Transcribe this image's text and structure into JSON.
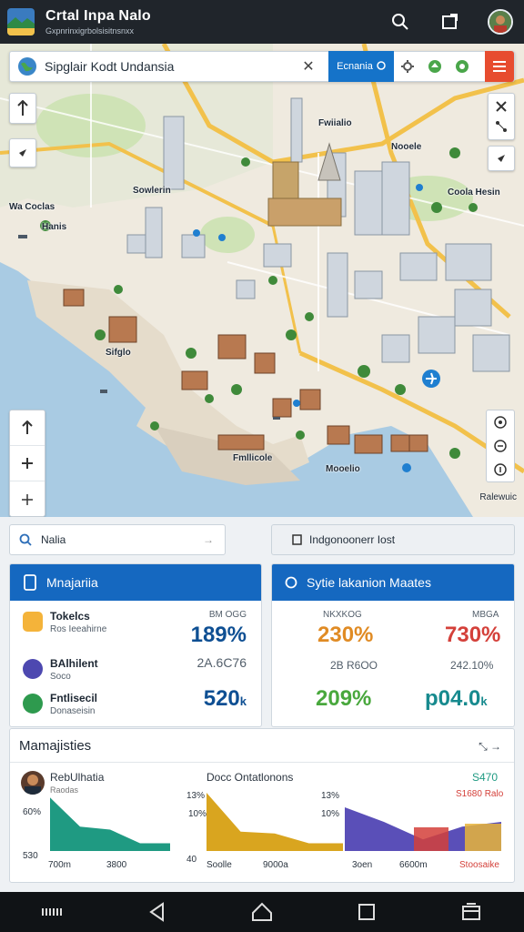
{
  "app": {
    "title": "Crtal Inpa Nalo",
    "subtitle": "Gxpnrinxigrbolsisitnsnxx"
  },
  "search": {
    "value": "Sipglair Kodt Undansia",
    "chip_label": "Ecnania"
  },
  "map_labels": [
    "Sowlerin",
    "Wa Coclas",
    "Hanis",
    "Sifglo",
    "Nooele",
    "Coola Hesin",
    "Fmllicole",
    "Mooelio",
    "Fwiialio",
    "Ralewuic"
  ],
  "attribution": "Ralewuic",
  "fields": {
    "left_value": "Nalia",
    "right_value": "Indgonoonerr Iost"
  },
  "left_card": {
    "title": "Mnajariia",
    "rows": [
      {
        "title": "Tokelcs",
        "sub": "Ros Ieeahirne",
        "small": "BM OGG",
        "big": "189%",
        "icon_color": "#f0a326"
      },
      {
        "title": "BAlhilent",
        "sub": "Soco",
        "small": "",
        "big": "2A.6C76",
        "icon_color": "#4d48b0"
      },
      {
        "title": "Fntlisecil",
        "sub": "Donaseisin",
        "small": "",
        "big": "520",
        "big_suffix": "k",
        "icon_color": "#2e9a4e"
      }
    ]
  },
  "right_card": {
    "title": "Sytie lakanion Maates",
    "cols": [
      {
        "small": "NKXKOG",
        "big": "230%",
        "color": "#e08b24"
      },
      {
        "small": "MBGA",
        "big": "730%",
        "color": "#d4403a"
      },
      {
        "small": "2B R6OO",
        "big": "",
        "color": "#525e6a"
      },
      {
        "small": "242.10%",
        "big": "",
        "color": "#525e6a"
      },
      {
        "small": "",
        "big": "209%",
        "color": "#49a83d"
      },
      {
        "small": "",
        "big": "p04.0",
        "big_suffix": "k",
        "color": "#178a8e"
      }
    ]
  },
  "bottom_card": {
    "title": "Mamajisties",
    "action": "⤡ →",
    "person_name": "RebUlhatia",
    "person_sub": "Raodas",
    "center_title": "Docc Ontatlonons",
    "right_value": "S470",
    "right_sub": "S1680 Ralo",
    "axis_labels_left": [
      "60%",
      "530"
    ],
    "axis_labels_mid": [
      "13%",
      "10%",
      "40"
    ],
    "axis_labels_right": [
      "13%",
      "10%"
    ],
    "x_labels": [
      "700m",
      "3800",
      "Soolle",
      "9000a",
      "3oen",
      "6600m",
      "Stoosaike"
    ]
  },
  "charts": [
    {
      "type": "area",
      "color": "#1f9a82",
      "values": [
        55,
        25,
        22,
        8,
        8
      ]
    },
    {
      "type": "area",
      "color": "#d9a51f",
      "values": [
        60,
        20,
        18,
        8,
        8
      ]
    },
    {
      "type": "area",
      "color": "#5a4fb8",
      "values": [
        45,
        30,
        12,
        25,
        30
      ]
    }
  ]
}
